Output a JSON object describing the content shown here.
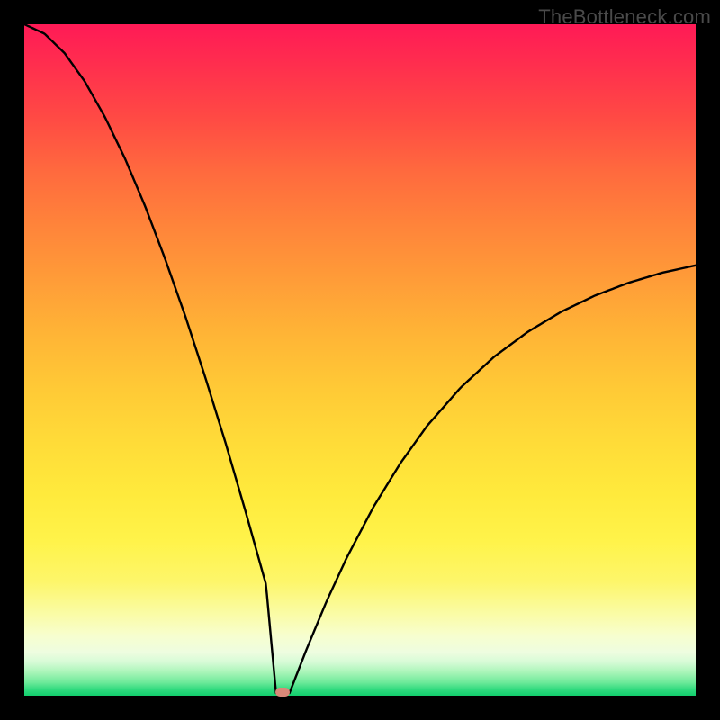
{
  "watermark": "TheBottleneck.com",
  "colors": {
    "frame": "#000000",
    "curve": "#000000",
    "marker": "#d98878"
  },
  "chart_data": {
    "type": "line",
    "title": "",
    "xlabel": "",
    "ylabel": "",
    "xlim": [
      0,
      1
    ],
    "ylim": [
      0,
      1
    ],
    "grid": false,
    "legend": false,
    "annotations": [
      {
        "text": "TheBottleneck.com",
        "position": "top-right"
      }
    ],
    "marker": {
      "x": 0.385,
      "y": 0.004,
      "shape": "rounded-rect",
      "color": "#d98878"
    },
    "series": [
      {
        "name": "left-branch",
        "note": "y ≈ 1 − (x / 0.375)^1.7 for x ∈ [0, 0.375]; monotone decreasing to minimum",
        "x": [
          0.0,
          0.03,
          0.06,
          0.09,
          0.12,
          0.15,
          0.18,
          0.21,
          0.24,
          0.27,
          0.3,
          0.33,
          0.36,
          0.375
        ],
        "y": [
          1.0,
          0.986,
          0.957,
          0.915,
          0.862,
          0.8,
          0.729,
          0.65,
          0.565,
          0.473,
          0.376,
          0.273,
          0.166,
          0.004
        ]
      },
      {
        "name": "right-branch",
        "note": "y ≈ 0.73·(1 − exp(−3.9·(x − 0.395))) for x ∈ [0.395, 1]; monotone increasing, saturating ≈0.71",
        "x": [
          0.395,
          0.42,
          0.45,
          0.48,
          0.52,
          0.56,
          0.6,
          0.65,
          0.7,
          0.75,
          0.8,
          0.85,
          0.9,
          0.95,
          1.0
        ],
        "y": [
          0.004,
          0.068,
          0.14,
          0.205,
          0.281,
          0.346,
          0.402,
          0.459,
          0.505,
          0.542,
          0.572,
          0.596,
          0.615,
          0.63,
          0.641
        ]
      }
    ],
    "background_gradient": {
      "direction": "top-to-bottom",
      "stops": [
        {
          "pos": 0.0,
          "color": "#ff1a56"
        },
        {
          "pos": 0.3,
          "color": "#ff843a"
        },
        {
          "pos": 0.62,
          "color": "#ffdb38"
        },
        {
          "pos": 0.88,
          "color": "#fafca8"
        },
        {
          "pos": 0.96,
          "color": "#a9f5b8"
        },
        {
          "pos": 1.0,
          "color": "#12cf6d"
        }
      ]
    }
  }
}
